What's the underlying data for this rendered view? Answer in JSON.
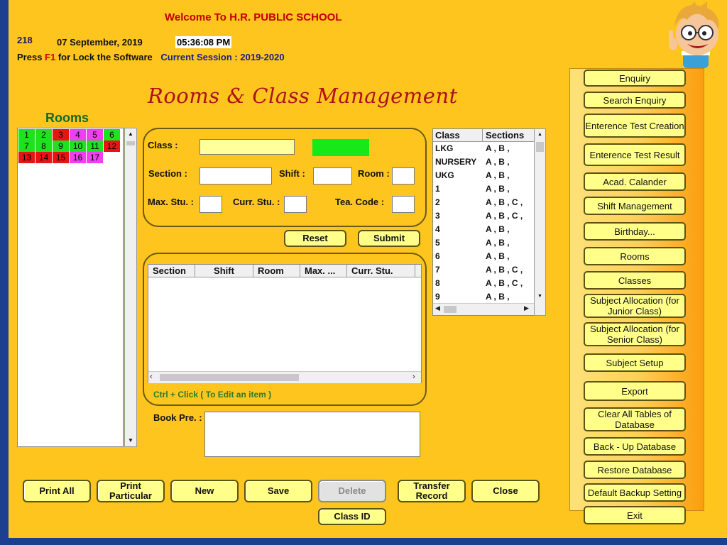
{
  "header": {
    "welcome": "Welcome To  H.R. PUBLIC SCHOOL",
    "code": "218",
    "date": "07  September, 2019",
    "time": "05:36:08 PM",
    "lock_prefix": "Press",
    "lock_key": "F1",
    "lock_suffix": "for Lock the Software",
    "session_label": "Current Session :",
    "session_value": "2019-2020"
  },
  "page_title": "Rooms & Class Management",
  "rooms": {
    "title": "Rooms",
    "cells": [
      {
        "label": "1",
        "color": "#1ee21e"
      },
      {
        "label": "2",
        "color": "#1ee21e"
      },
      {
        "label": "3",
        "color": "#e81414"
      },
      {
        "label": "4",
        "color": "#ef3fef"
      },
      {
        "label": "5",
        "color": "#ef3fef"
      },
      {
        "label": "6",
        "color": "#1ee21e"
      },
      {
        "label": "7",
        "color": "#1ee21e"
      },
      {
        "label": "8",
        "color": "#1ee21e"
      },
      {
        "label": "9",
        "color": "#1ee21e"
      },
      {
        "label": "10",
        "color": "#1ee21e"
      },
      {
        "label": "11",
        "color": "#1ee21e"
      },
      {
        "label": "12",
        "color": "#e81414"
      },
      {
        "label": "13",
        "color": "#e81414"
      },
      {
        "label": "14",
        "color": "#e81414"
      },
      {
        "label": "15",
        "color": "#e81414"
      },
      {
        "label": "16",
        "color": "#ef3fef"
      },
      {
        "label": "17",
        "color": "#ef3fef"
      }
    ]
  },
  "form": {
    "class_label": "Class :",
    "section_label": "Section :",
    "shift_label": "Shift :",
    "room_label": "Room :",
    "max_stu_label": "Max. Stu. :",
    "curr_stu_label": "Curr. Stu. :",
    "tea_code_label": "Tea. Code :",
    "class_value": "",
    "section_value": "",
    "shift_value": "",
    "room_value": "",
    "max_stu_value": "",
    "curr_stu_value": "",
    "tea_code_value": "",
    "status_color": "#17e817",
    "reset_label": "Reset",
    "submit_label": "Submit"
  },
  "grid": {
    "columns": [
      "Section",
      "Shift",
      "Room",
      "Max. ...",
      "Curr. Stu."
    ],
    "hint": "Ctrl + Click ( To Edit an item )"
  },
  "book_pre_label": "Book Pre. :",
  "class_list": {
    "columns": [
      "Class",
      "Sections"
    ],
    "rows": [
      {
        "class": "LKG",
        "sections": "A , B ,"
      },
      {
        "class": "NURSERY",
        "sections": "A , B ,"
      },
      {
        "class": "UKG",
        "sections": "A , B ,"
      },
      {
        "class": "1",
        "sections": "A , B ,"
      },
      {
        "class": "2",
        "sections": "A , B , C ,"
      },
      {
        "class": "3",
        "sections": "A , B , C ,"
      },
      {
        "class": "4",
        "sections": "A , B ,"
      },
      {
        "class": "5",
        "sections": "A , B ,"
      },
      {
        "class": "6",
        "sections": "A , B ,"
      },
      {
        "class": "7",
        "sections": "A , B , C ,"
      },
      {
        "class": "8",
        "sections": "A , B , C ,"
      },
      {
        "class": "9",
        "sections": "A , B ,"
      }
    ]
  },
  "bottom_buttons": {
    "print_all": "Print All",
    "print_particular_1": "Print",
    "print_particular_2": "Particular",
    "new": "New",
    "save": "Save",
    "delete": "Delete",
    "transfer_1": "Transfer",
    "transfer_2": "Record",
    "close": "Close",
    "class_id": "Class ID"
  },
  "menu": {
    "items": [
      "Enquiry",
      "Search Enquiry",
      "Enterence Test Creation",
      "Enterence Test Result",
      "Acad. Calander",
      "Shift Management",
      "Birthday...",
      "Rooms",
      "Classes",
      "Subject Allocation (for Junior Class)",
      "Subject Allocation (for Senior Class)",
      "Subject Setup",
      "Export",
      "Clear All Tables of Database",
      "Back - Up Database",
      "Restore Database",
      "Default Backup Setting",
      "Exit"
    ]
  },
  "icons": {
    "mascot": "cartoon-boy-mascot-icon",
    "scroll_up": "scroll-up-arrow-icon",
    "scroll_down": "scroll-down-arrow-icon",
    "scroll_left": "scroll-left-arrow-icon",
    "scroll_right": "scroll-right-arrow-icon"
  }
}
